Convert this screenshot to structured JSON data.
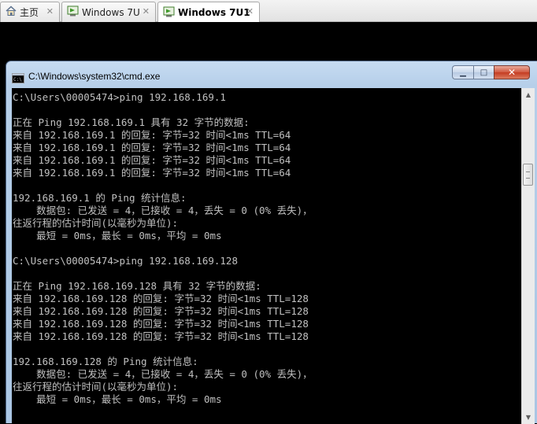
{
  "tabs": [
    {
      "label": "主页",
      "icon": "home-icon",
      "active": false
    },
    {
      "label": "Windows 7U",
      "icon": "vm-icon",
      "active": false
    },
    {
      "label": "Windows 7U1",
      "icon": "vm-icon",
      "active": true
    }
  ],
  "tab_close_glyph": "✕",
  "window": {
    "title": "C:\\Windows\\system32\\cmd.exe",
    "icon": "cmd-icon",
    "min_glyph": "▁",
    "max_glyph": "□",
    "close_glyph": "✕"
  },
  "console": {
    "lines": [
      "C:\\Users\\00005474>ping 192.168.169.1",
      "",
      "正在 Ping 192.168.169.1 具有 32 字节的数据:",
      "来自 192.168.169.1 的回复: 字节=32 时间<1ms TTL=64",
      "来自 192.168.169.1 的回复: 字节=32 时间<1ms TTL=64",
      "来自 192.168.169.1 的回复: 字节=32 时间<1ms TTL=64",
      "来自 192.168.169.1 的回复: 字节=32 时间<1ms TTL=64",
      "",
      "192.168.169.1 的 Ping 统计信息:",
      "    数据包: 已发送 = 4，已接收 = 4，丢失 = 0 (0% 丢失)，",
      "往返行程的估计时间(以毫秒为单位):",
      "    最短 = 0ms，最长 = 0ms，平均 = 0ms",
      "",
      "C:\\Users\\00005474>ping 192.168.169.128",
      "",
      "正在 Ping 192.168.169.128 具有 32 字节的数据:",
      "来自 192.168.169.128 的回复: 字节=32 时间<1ms TTL=128",
      "来自 192.168.169.128 的回复: 字节=32 时间<1ms TTL=128",
      "来自 192.168.169.128 的回复: 字节=32 时间<1ms TTL=128",
      "来自 192.168.169.128 的回复: 字节=32 时间<1ms TTL=128",
      "",
      "192.168.169.128 的 Ping 统计信息:",
      "    数据包: 已发送 = 4，已接收 = 4，丢失 = 0 (0% 丢失)，",
      "往返行程的估计时间(以毫秒为单位):",
      "    最短 = 0ms，最长 = 0ms，平均 = 0ms"
    ]
  },
  "scrollbar": {
    "up_glyph": "▲",
    "down_glyph": "▼"
  },
  "colors": {
    "console_bg": "#000000",
    "console_text": "#c0c0c0",
    "close_button": "#c43c22"
  }
}
